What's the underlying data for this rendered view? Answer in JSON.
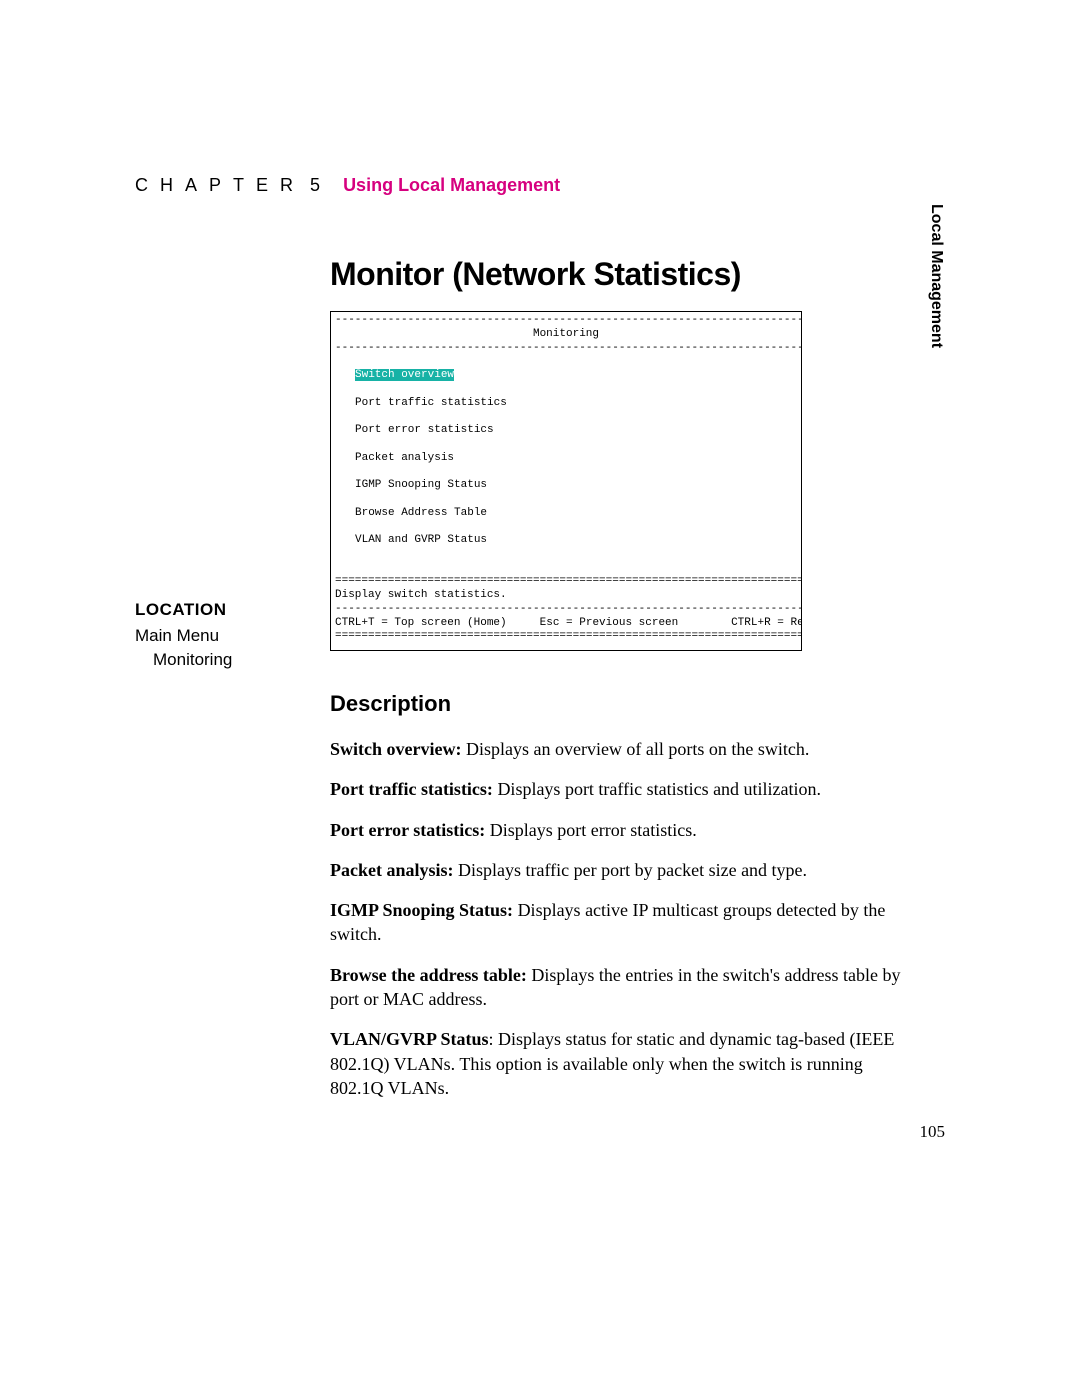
{
  "header": {
    "chapter_word": "CHAPTER",
    "chapter_num": "5",
    "section": "Using Local Management"
  },
  "side_tab": "Local Management",
  "title": "Monitor (Network Statistics)",
  "terminal": {
    "dash80a": "--------------------------------------------------------------------------------",
    "title": "Monitoring",
    "dash80b": "--------------------------------------------------------------------------------",
    "sel": "Switch overview",
    "items": [
      "Port traffic statistics",
      "Port error statistics",
      "Packet analysis",
      "IGMP Snooping Status",
      "Browse Address Table",
      "VLAN and GVRP Status"
    ],
    "eq80a": "================================================================================",
    "helpline": "Display switch statistics.",
    "dash80c": "--------------------------------------------------------------------------------",
    "footline": "CTRL+T = Top screen (Home)     Esc = Previous screen        CTRL+R = Refresh",
    "eq80b": "================================================================================"
  },
  "location": {
    "title": "LOCATION",
    "l1": "Main Menu",
    "l2": "Monitoring"
  },
  "description": {
    "title": "Description",
    "items": [
      {
        "b": "Switch overview:",
        "t": " Displays an overview of all ports on the switch."
      },
      {
        "b": "Port traffic statistics:",
        "t": " Displays port traffic statistics and utilization."
      },
      {
        "b": "Port error statistics:",
        "t": " Displays port error statistics."
      },
      {
        "b": "Packet analysis:",
        "t": " Displays traffic per port by packet size and type."
      },
      {
        "b": "IGMP Snooping Status:",
        "t": " Displays active IP multicast groups detected by the switch."
      },
      {
        "b": "Browse the address table:",
        "t": " Displays the entries in the switch's address table by port or MAC address."
      },
      {
        "b": "VLAN/GVRP Status",
        "t": ": Displays status for static and dynamic tag-based (IEEE 802.1Q) VLANs. This option is available only when the switch is running 802.1Q VLANs."
      }
    ]
  },
  "page_num": "105"
}
